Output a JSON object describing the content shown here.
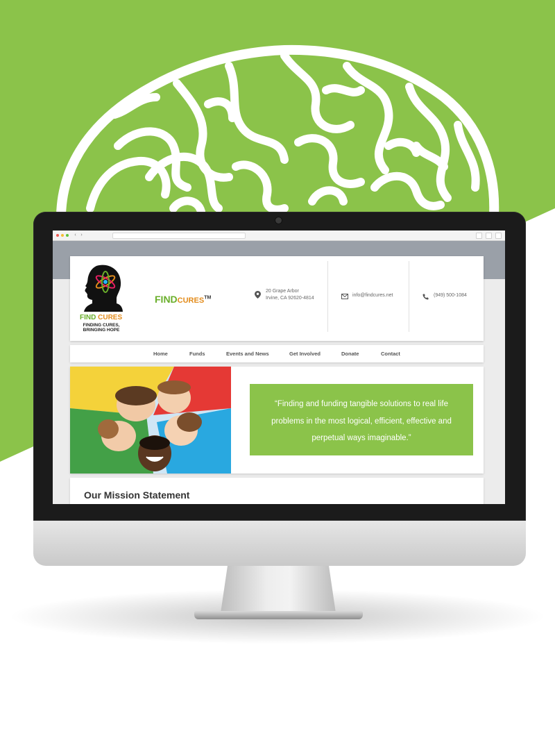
{
  "colors": {
    "accent_green": "#8bc34a",
    "brand_green": "#6aaf2b",
    "brand_orange": "#e38c1c"
  },
  "browser": {
    "icons": [
      "close-dot-icon",
      "minimize-dot-icon",
      "maximize-dot-icon",
      "back-icon",
      "forward-icon"
    ]
  },
  "header": {
    "logo": {
      "find": "FIND",
      "cures": "CURES",
      "tagline_line1": "FINDING CURES,",
      "tagline_line2": "BRINGING HOPE"
    },
    "brand": {
      "find": "FIND",
      "cures": "CURES",
      "tm": "TM"
    },
    "address_line1": "20 Grape Arbor",
    "address_line2": "Irvine, CA 92620-4814",
    "email": "info@findcures.net",
    "phone": "(949) 500-1084"
  },
  "nav": {
    "items": [
      "Home",
      "Funds",
      "Events and News",
      "Get Involved",
      "Donate",
      "Contact"
    ]
  },
  "hero": {
    "quote": "“Finding and funding tangible solutions to real life problems in the most logical, efficient, effective and perpetual ways imaginable.”"
  },
  "mission": {
    "title": "Our Mission Statement"
  }
}
